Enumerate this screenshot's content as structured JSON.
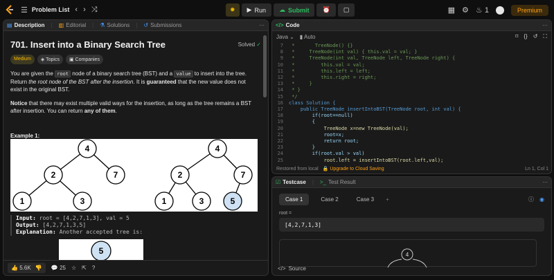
{
  "topbar": {
    "problem_list": "Problem List",
    "run": "Run",
    "submit": "Submit",
    "streak": "1",
    "premium": "Premium"
  },
  "desc_tabs": [
    "Description",
    "Editorial",
    "Solutions",
    "Submissions"
  ],
  "problem": {
    "title": "701. Insert into a Binary Search Tree",
    "solved": "Solved",
    "difficulty": "Medium",
    "topics": "Topics",
    "companies": "Companies",
    "p1_a": "You are given the ",
    "p1_code1": "root",
    "p1_b": " node of a binary search tree (BST) and a ",
    "p1_code2": "value",
    "p1_c": " to insert into the tree. Return ",
    "p1_em1": "the root node of the BST after the insertion",
    "p1_d": ". It is ",
    "p1_strong": "guaranteed",
    "p1_e": " that the new value does not exist in the original BST.",
    "p2_strong": "Notice",
    "p2_a": " that there may exist multiple valid ways for the insertion, as long as the tree remains a BST after insertion. You can return ",
    "p2_strong2": "any of them",
    "p2_b": ".",
    "example_title": "Example 1:",
    "tree_left": [
      "4",
      "2",
      "7",
      "1",
      "3"
    ],
    "tree_right": [
      "4",
      "2",
      "7",
      "1",
      "3",
      "5"
    ],
    "tree_alt_root": "5",
    "input_label": "Input:",
    "input_value": "root = [4,2,7,1,3], val = 5",
    "output_label": "Output:",
    "output_value": "[4,2,7,1,3,5]",
    "explanation_label": "Explanation:",
    "explanation_value": "Another accepted tree is:"
  },
  "footer": {
    "likes": "5.6K",
    "comments": "25"
  },
  "code": {
    "title": "Code",
    "language": "Java",
    "mode": "Auto",
    "saved": "Restored from local",
    "upgrade": "Upgrade to Cloud Saving",
    "cursor": "Ln 1, Col 1",
    "lines": [
      {
        "n": "7",
        "t": " *       TreeNode() {}"
      },
      {
        "n": "8",
        "t": " *     TreeNode(int val) { this.val = val; }"
      },
      {
        "n": "9",
        "t": " *     TreeNode(int val, TreeNode left, TreeNode right) {"
      },
      {
        "n": "10",
        "t": " *         this.val = val;"
      },
      {
        "n": "11",
        "t": " *         this.left = left;"
      },
      {
        "n": "12",
        "t": " *         this.right = right;"
      },
      {
        "n": "13",
        "t": " *     }"
      },
      {
        "n": "14",
        "t": " * }"
      },
      {
        "n": "15",
        "t": " */"
      },
      {
        "n": "16",
        "t": "class Solution {"
      },
      {
        "n": "17",
        "t": "    public TreeNode insertIntoBST(TreeNode root, int val) {"
      },
      {
        "n": "18",
        "t": "        if(root==null)"
      },
      {
        "n": "19",
        "t": "        {"
      },
      {
        "n": "20",
        "t": "            TreeNode x=new TreeNode(val);"
      },
      {
        "n": "21",
        "t": "            root=x;"
      },
      {
        "n": "22",
        "t": "            return root;"
      },
      {
        "n": "23",
        "t": "        }"
      },
      {
        "n": "24",
        "t": "        if(root.val > val)"
      },
      {
        "n": "25",
        "t": "            root.left = insertIntoBST(root.left,val);"
      }
    ]
  },
  "testcase": {
    "tab1": "Testcase",
    "tab2": "Test Result",
    "cases": [
      "Case 1",
      "Case 2",
      "Case 3"
    ],
    "root_label": "root =",
    "root_value": "[4,2,7,1,3]",
    "preview_root": "4",
    "source": "Source"
  }
}
